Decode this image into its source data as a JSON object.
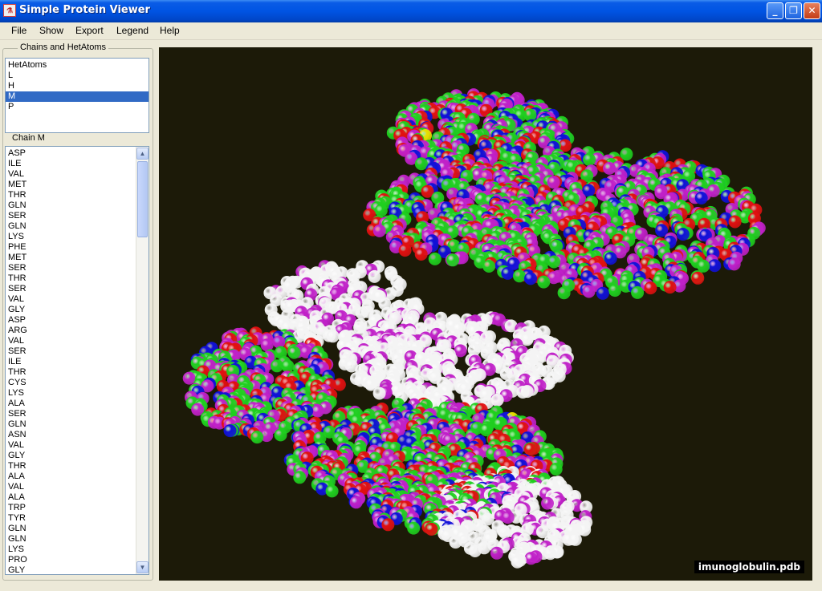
{
  "window": {
    "title": "Simple Protein Viewer",
    "icon": "protein-app-icon"
  },
  "window_controls": {
    "minimize": "_",
    "maximize": "❐",
    "close": "✕"
  },
  "menu": [
    "File",
    "Show",
    "Export",
    "Legend",
    "Help"
  ],
  "chains_panel": {
    "label": "Chains and HetAtoms",
    "items": [
      "HetAtoms",
      "L",
      "H",
      "M",
      "P"
    ],
    "selected": "M"
  },
  "residue_panel": {
    "label": "Chain M",
    "items": [
      "ASP",
      "ILE",
      "VAL",
      "MET",
      "THR",
      "GLN",
      "SER",
      "GLN",
      "LYS",
      "PHE",
      "MET",
      "SER",
      "THR",
      "SER",
      "VAL",
      "GLY",
      "ASP",
      "ARG",
      "VAL",
      "SER",
      "ILE",
      "THR",
      "CYS",
      "LYS",
      "ALA",
      "SER",
      "GLN",
      "ASN",
      "VAL",
      "GLY",
      "THR",
      "ALA",
      "VAL",
      "ALA",
      "TRP",
      "TYR",
      "GLN",
      "GLN",
      "LYS",
      "PRO",
      "GLY"
    ]
  },
  "viewer": {
    "filename": "imunoglobulin.pdb",
    "background": "#1c1a08",
    "atom_colors": {
      "carbon": "#1fcf1f",
      "oxygen": "#e01010",
      "nitrogen": "#1010d8",
      "other": "#c020c8",
      "hetero": "#f4f4f4",
      "sulfur": "#e8e000"
    }
  }
}
